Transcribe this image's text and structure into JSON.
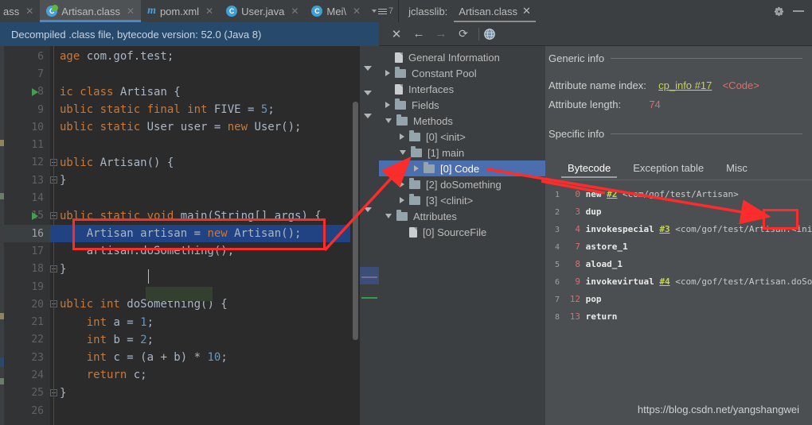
{
  "window": {
    "top_right_icons": [
      "gear-icon",
      "minimize-icon"
    ]
  },
  "tabbar": {
    "tabs": [
      {
        "label": "ass",
        "icon": "none",
        "active": false,
        "clipped": true
      },
      {
        "label": "Artisan.class",
        "icon": "class-icon",
        "active": true,
        "clipped": false
      },
      {
        "label": "pom.xml",
        "icon": "maven-icon",
        "active": false,
        "clipped": false
      },
      {
        "label": "User.java",
        "icon": "class-icon",
        "active": false,
        "clipped": false
      },
      {
        "label": "Mei\\",
        "icon": "class-icon",
        "active": false,
        "clipped": false
      }
    ],
    "overflow_count": "7",
    "jclasslib_label": "jclasslib:",
    "jclasslib_tab": "Artisan.class"
  },
  "notification": {
    "text": "Decompiled .class file, bytecode version: 52.0 (Java 8)",
    "close_label": "✕"
  },
  "toolbar": {
    "buttons": [
      "close-icon",
      "back-arrow-icon",
      "forward-arrow-icon",
      "refresh-icon",
      "browser-globe-icon"
    ]
  },
  "editor": {
    "first_line": 6,
    "current_line": 16,
    "lines": [
      {
        "n": 6,
        "segments": [
          {
            "t": "age ",
            "c": "kw"
          },
          {
            "t": "com.gof.test;",
            "c": "plain"
          }
        ],
        "indent": 0,
        "fold": null,
        "run": false
      },
      {
        "n": 7,
        "segments": [],
        "indent": 0,
        "fold": null,
        "run": false
      },
      {
        "n": 8,
        "segments": [
          {
            "t": "ic ",
            "c": "kw"
          },
          {
            "t": "class ",
            "c": "kw"
          },
          {
            "t": "Artisan {",
            "c": "plain"
          }
        ],
        "indent": 0,
        "fold": null,
        "run": true
      },
      {
        "n": 9,
        "segments": [
          {
            "t": "ublic static final int ",
            "c": "kw"
          },
          {
            "t": "FIVE = ",
            "c": "plain"
          },
          {
            "t": "5",
            "c": "num"
          },
          {
            "t": ";",
            "c": "plain"
          }
        ],
        "indent": 0,
        "fold": null,
        "run": false
      },
      {
        "n": 10,
        "segments": [
          {
            "t": "ublic static ",
            "c": "kw"
          },
          {
            "t": "User user = ",
            "c": "plain"
          },
          {
            "t": "new ",
            "c": "kw"
          },
          {
            "t": "User();",
            "c": "plain"
          }
        ],
        "indent": 0,
        "fold": null,
        "run": false
      },
      {
        "n": 11,
        "segments": [],
        "indent": 0,
        "fold": null,
        "run": false
      },
      {
        "n": 12,
        "segments": [
          {
            "t": "ublic ",
            "c": "kw"
          },
          {
            "t": "Artisan() {",
            "c": "plain"
          }
        ],
        "indent": 0,
        "fold": "open",
        "run": false
      },
      {
        "n": 13,
        "segments": [
          {
            "t": "}",
            "c": "plain"
          }
        ],
        "indent": 0,
        "fold": "close",
        "run": false
      },
      {
        "n": 14,
        "segments": [],
        "indent": 0,
        "fold": null,
        "run": false
      },
      {
        "n": 15,
        "segments": [
          {
            "t": "ublic static void ",
            "c": "kw"
          },
          {
            "t": "main(String[] args) {",
            "c": "plain"
          }
        ],
        "indent": 0,
        "fold": "open",
        "run": true
      },
      {
        "n": 16,
        "segments": [
          {
            "t": "    Artisan artisan = ",
            "c": "plain"
          },
          {
            "t": "new ",
            "c": "kw"
          },
          {
            "t": "Artisan();",
            "c": "plain"
          }
        ],
        "indent": 0,
        "fold": null,
        "run": false
      },
      {
        "n": 17,
        "segments": [
          {
            "t": "    artisan",
            "c": "plain"
          },
          {
            "t": ".doSomething();",
            "c": "plain"
          }
        ],
        "indent": 0,
        "fold": null,
        "run": false
      },
      {
        "n": 18,
        "segments": [
          {
            "t": "}",
            "c": "plain"
          }
        ],
        "indent": 0,
        "fold": "close",
        "run": false
      },
      {
        "n": 19,
        "segments": [],
        "indent": 0,
        "fold": null,
        "run": false
      },
      {
        "n": 20,
        "segments": [
          {
            "t": "ublic int ",
            "c": "kw"
          },
          {
            "t": "doSomething() {",
            "c": "plain"
          }
        ],
        "indent": 0,
        "fold": "open",
        "run": false
      },
      {
        "n": 21,
        "segments": [
          {
            "t": "    int ",
            "c": "kw"
          },
          {
            "t": "a = ",
            "c": "plain"
          },
          {
            "t": "1",
            "c": "num"
          },
          {
            "t": ";",
            "c": "plain"
          }
        ],
        "indent": 0,
        "fold": null,
        "run": false
      },
      {
        "n": 22,
        "segments": [
          {
            "t": "    int ",
            "c": "kw"
          },
          {
            "t": "b = ",
            "c": "plain"
          },
          {
            "t": "2",
            "c": "num"
          },
          {
            "t": ";",
            "c": "plain"
          }
        ],
        "indent": 0,
        "fold": null,
        "run": false
      },
      {
        "n": 23,
        "segments": [
          {
            "t": "    int ",
            "c": "kw"
          },
          {
            "t": "c = (a + b) * ",
            "c": "plain"
          },
          {
            "t": "10",
            "c": "num"
          },
          {
            "t": ";",
            "c": "plain"
          }
        ],
        "indent": 0,
        "fold": null,
        "run": false
      },
      {
        "n": 24,
        "segments": [
          {
            "t": "    return ",
            "c": "kw"
          },
          {
            "t": "c;",
            "c": "plain"
          }
        ],
        "indent": 0,
        "fold": null,
        "run": false
      },
      {
        "n": 25,
        "segments": [
          {
            "t": "}",
            "c": "plain"
          }
        ],
        "indent": 0,
        "fold": "close",
        "run": false
      },
      {
        "n": 26,
        "segments": [],
        "indent": 0,
        "fold": null,
        "run": false
      }
    ]
  },
  "tree": {
    "nodes": [
      {
        "label": "General Information",
        "depth": 0,
        "twisty": "none",
        "icon": "file-icon",
        "selected": false
      },
      {
        "label": "Constant Pool",
        "depth": 0,
        "twisty": "closed",
        "icon": "folder-icon",
        "selected": false
      },
      {
        "label": "Interfaces",
        "depth": 0,
        "twisty": "none",
        "icon": "file-icon",
        "selected": false
      },
      {
        "label": "Fields",
        "depth": 0,
        "twisty": "closed",
        "icon": "folder-icon",
        "selected": false
      },
      {
        "label": "Methods",
        "depth": 0,
        "twisty": "open",
        "icon": "folder-icon",
        "selected": false
      },
      {
        "label": "[0] <init>",
        "depth": 1,
        "twisty": "closed",
        "icon": "folder-icon",
        "selected": false
      },
      {
        "label": "[1] main",
        "depth": 1,
        "twisty": "open",
        "icon": "folder-icon",
        "selected": false
      },
      {
        "label": "[0] Code",
        "depth": 2,
        "twisty": "closed",
        "icon": "folder-icon",
        "selected": true
      },
      {
        "label": "[2] doSomething",
        "depth": 1,
        "twisty": "closed",
        "icon": "folder-icon",
        "selected": false
      },
      {
        "label": "[3] <clinit>",
        "depth": 1,
        "twisty": "closed",
        "icon": "folder-icon",
        "selected": false
      },
      {
        "label": "Attributes",
        "depth": 0,
        "twisty": "open",
        "icon": "folder-icon",
        "selected": false
      },
      {
        "label": "[0] SourceFile",
        "depth": 1,
        "twisty": "none",
        "icon": "file-icon",
        "selected": false
      }
    ]
  },
  "detail": {
    "generic_info_title": "Generic info",
    "attribute_name_index_label": "Attribute name index:",
    "attribute_name_index_link": "cp_info #17",
    "attribute_name_index_value": "<Code>",
    "attribute_length_label": "Attribute length:",
    "attribute_length_value": "74",
    "specific_info_title": "Specific info",
    "tabs": [
      {
        "label": "Bytecode",
        "active": true
      },
      {
        "label": "Exception table",
        "active": false
      },
      {
        "label": "Misc",
        "active": false
      }
    ],
    "bytecode": [
      {
        "idx": "1",
        "offset": "0",
        "op": "new",
        "ref": "#2",
        "comment": "<com/gof/test/Artisan>"
      },
      {
        "idx": "2",
        "offset": "3",
        "op": "dup",
        "ref": "",
        "comment": ""
      },
      {
        "idx": "3",
        "offset": "4",
        "op": "invokespecial",
        "ref": "#3",
        "comment": "<com/gof/test/Artisan.<init>>"
      },
      {
        "idx": "4",
        "offset": "7",
        "op": "astore_1",
        "ref": "",
        "comment": ""
      },
      {
        "idx": "5",
        "offset": "8",
        "op": "aload_1",
        "ref": "",
        "comment": ""
      },
      {
        "idx": "6",
        "offset": "9",
        "op": "invokevirtual",
        "ref": "#4",
        "comment": "<com/gof/test/Artisan.doSomething"
      },
      {
        "idx": "7",
        "offset": "12",
        "op": "pop",
        "ref": "",
        "comment": ""
      },
      {
        "idx": "8",
        "offset": "13",
        "op": "return",
        "ref": "",
        "comment": ""
      }
    ]
  },
  "watermark": {
    "text": "https://blog.csdn.net/yangshangwei"
  },
  "colors": {
    "annotation_red": "#fb2c2c",
    "selection_blue": "#4b6eaf",
    "editor_bg": "#2b2b2b",
    "panel_bg": "#3c3f41",
    "detail_bg": "#4b4f51",
    "notification_bg": "#27496b",
    "keyword_orange": "#cc7832",
    "number_blue": "#6897bb",
    "link_yellow": "#c8d44a",
    "value_red": "#e06c6c"
  }
}
